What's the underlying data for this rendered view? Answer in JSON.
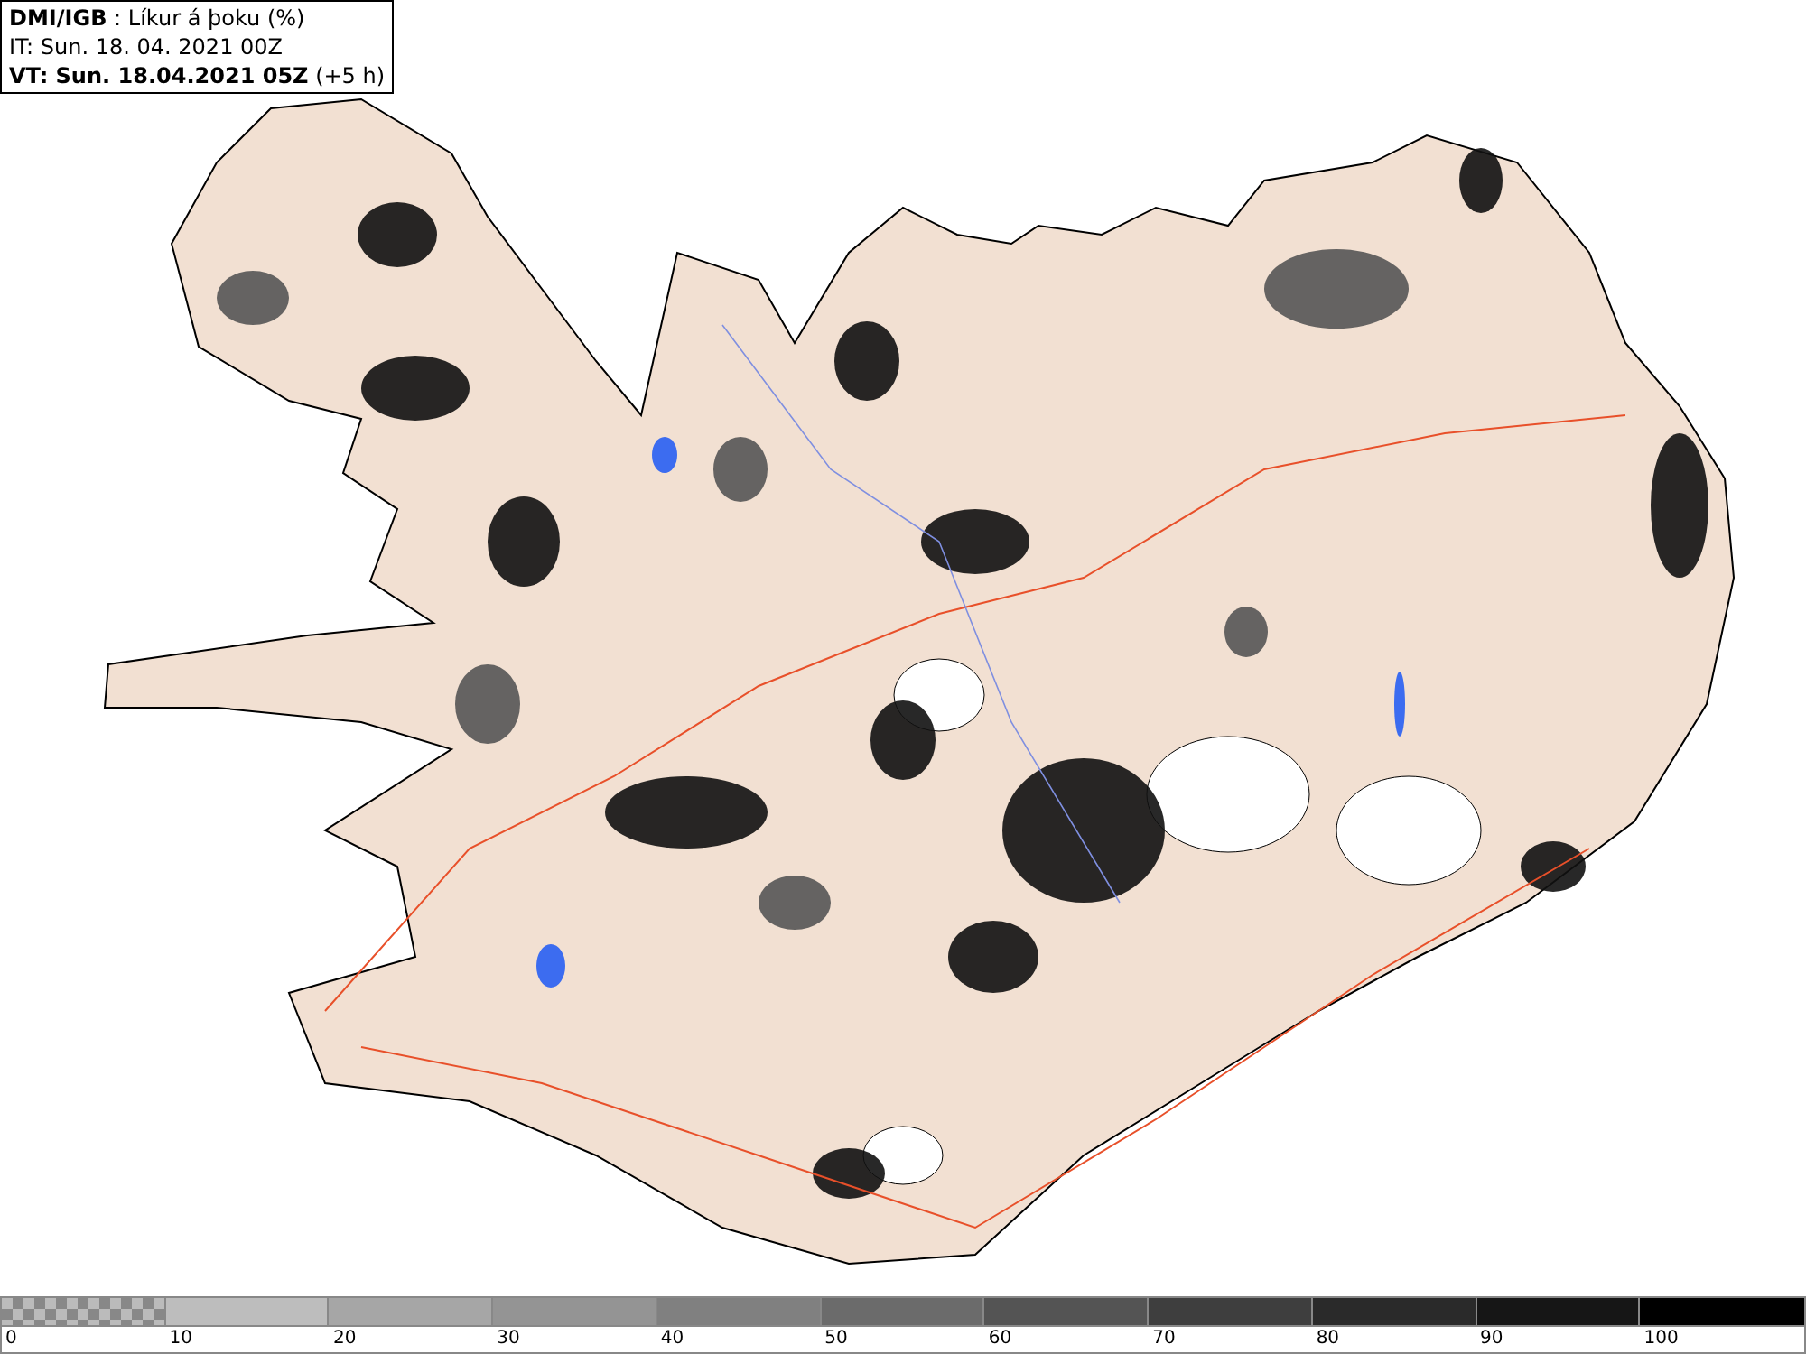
{
  "header": {
    "lines": [
      {
        "text": "**DMI/IGB** : Líkur á þoku (%)"
      },
      {
        "text": "IT: Sun. 18. 04. 2021 00Z"
      },
      {
        "text": "**VT: Sun. 18.04.2021 05Z** (+5 h)"
      }
    ]
  },
  "legend": {
    "segments": [
      {
        "kind": "checker"
      },
      {
        "color": "#bdbdbd",
        "kind": "solid"
      },
      {
        "color": "#a6a6a6",
        "kind": "solid"
      },
      {
        "color": "#949494",
        "kind": "solid"
      },
      {
        "color": "#808080",
        "kind": "solid"
      },
      {
        "color": "#6b6b6b",
        "kind": "solid"
      },
      {
        "color": "#545454",
        "kind": "solid"
      },
      {
        "color": "#3e3e3e",
        "kind": "solid"
      },
      {
        "color": "#2a2a2a",
        "kind": "solid"
      },
      {
        "color": "#161616",
        "kind": "solid"
      },
      {
        "color": "#000000",
        "kind": "solid"
      }
    ],
    "ticks": [
      "0",
      "10",
      "20",
      "30",
      "40",
      "50",
      "60",
      "70",
      "80",
      "90",
      "100"
    ]
  }
}
